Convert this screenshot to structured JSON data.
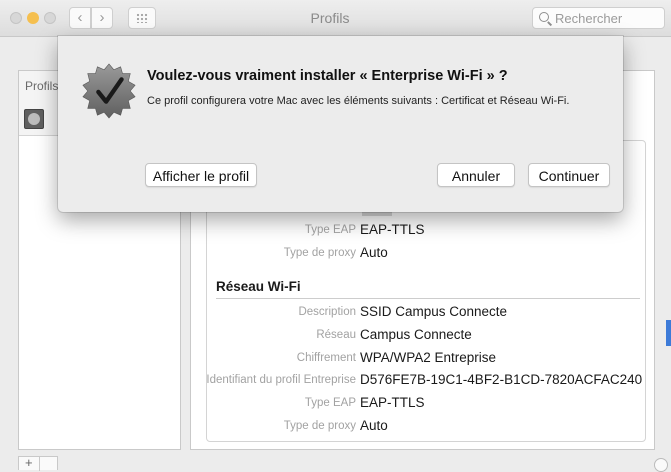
{
  "window": {
    "title": "Profils",
    "search_placeholder": "Rechercher"
  },
  "sidebar": {
    "header_label": "Profils d"
  },
  "dialog": {
    "title": "Voulez-vous vraiment installer « Enterprise Wi-Fi » ?",
    "message": "Ce profil configurera votre Mac avec les éléments suivants : Certificat et Réseau Wi-Fi.",
    "buttons": {
      "show_profile": "Afficher le profil",
      "cancel": "Annuler",
      "continue": "Continuer"
    }
  },
  "details": {
    "first_section_rows": [
      {
        "key": "Type EAP",
        "value": "EAP-TTLS"
      },
      {
        "key": "Type de proxy",
        "value": "Auto"
      }
    ],
    "wifi_section": {
      "title": "Réseau Wi-Fi",
      "rows": [
        {
          "key": "Description",
          "value": "SSID Campus Connecte"
        },
        {
          "key": "Réseau",
          "value": "Campus Connecte"
        },
        {
          "key": "Chiffrement",
          "value": "WPA/WPA2 Entreprise"
        },
        {
          "key": "Identifiant du profil Entreprise",
          "value": "D576FE7B-19C1-4BF2-B1CD-7820ACFAC240"
        },
        {
          "key": "Type EAP",
          "value": "EAP-TTLS"
        },
        {
          "key": "Type de proxy",
          "value": "Auto"
        }
      ]
    }
  },
  "icons": {
    "badge": "verified-checkmark-badge-icon",
    "search": "magnifier-icon"
  },
  "colors": {
    "accent_blue": "#3d7bd8",
    "minimize_yellow": "#f5bf4f"
  }
}
